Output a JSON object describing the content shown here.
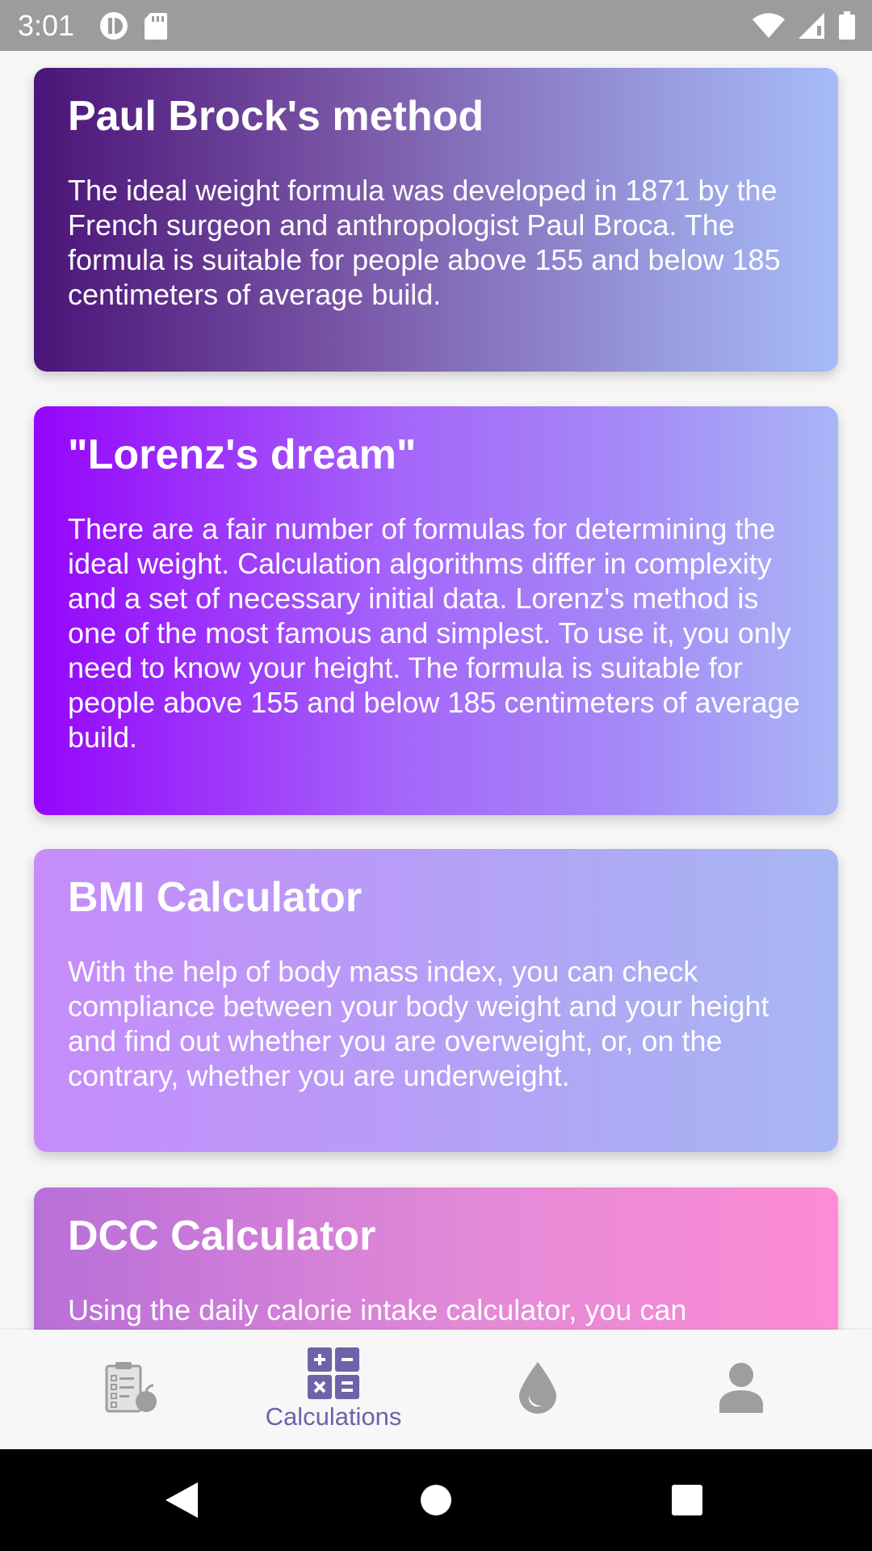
{
  "status_bar": {
    "time": "3:01"
  },
  "cards": [
    {
      "title": "Paul Brock's method",
      "text": "The ideal weight formula was developed in 1871 by the French surgeon and anthropologist Paul Broca. The formula is suitable for people above 155 and below 185 centimeters of average build."
    },
    {
      "title": "\"Lorenz's dream\"",
      "text": "There are a fair number of formulas for determining the ideal weight. Calculation algorithms differ in complexity and a set of necessary initial data. Lorenz's method is one of the most famous and simplest. To use it, you only need to know your height. The formula is suitable for people above 155 and below 185 centimeters of average build."
    },
    {
      "title": "BMI Calculator",
      "text": "With the help of body mass index, you can check compliance between your body weight and your height and find out whether you are overweight, or, on the contrary, whether you are underweight."
    },
    {
      "title": "DCC Calculator",
      "text": "Using the daily calorie intake calculator, you can"
    }
  ],
  "bottom_nav": {
    "items": [
      {
        "icon": "diet-clipboard-icon",
        "label": ""
      },
      {
        "icon": "calculator-icon",
        "label": "Calculations"
      },
      {
        "icon": "water-drop-icon",
        "label": ""
      },
      {
        "icon": "profile-icon",
        "label": ""
      }
    ],
    "active_color": "#6d63a8",
    "inactive_color": "#9e9e9e"
  },
  "system_nav": {
    "icons": [
      "back-icon",
      "home-icon",
      "recents-icon"
    ]
  }
}
